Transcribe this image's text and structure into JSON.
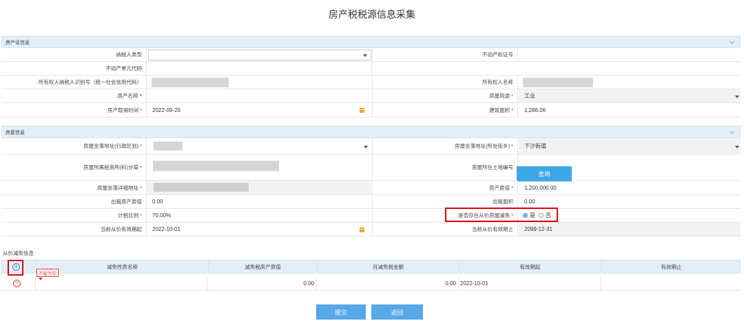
{
  "page_title": "房产税税源信息采集",
  "property_cert": {
    "section_title": "房产证信息",
    "taxpayer_type_label": "纳税人类型",
    "taxpayer_type_value": "",
    "real_estate_cert_label": "不动产权证号",
    "real_estate_cert_value": "",
    "unit_code_label": "不动产单元代码",
    "unit_code_value": "",
    "owner_id_label": "所有权人纳税人识别号（统一社会信用代码）",
    "owner_name_label": "所有权人名称",
    "property_name_label": "房产名称",
    "property_name_value": "",
    "house_use_label": "房屋用途",
    "house_use_value": "工业",
    "acquire_date_label": "房产取得时间",
    "acquire_date_value": "2022-09-20",
    "building_area_label": "建筑面积",
    "building_area_value": "1,286.06",
    "required_mark": "*"
  },
  "house_info": {
    "section_title": "房屋信息",
    "district_label": "房屋坐落地址(行政区划)",
    "street_label": "房屋坐落地址(所处街乡)",
    "street_value": "下沙街道",
    "tax_office_label": "房屋所属税务所(科)分局",
    "land_no_label": "房屋所在土地编号",
    "query_button": "查询",
    "detail_address_label": "房屋坐落详细地址",
    "original_value_label": "房产原值",
    "original_value": "1,200,000.00",
    "rent_original_label": "出租房产原值",
    "rent_original_value": "0.00",
    "rent_area_label": "出租面积",
    "rent_area_value": "0.00",
    "tax_ratio_label": "计税比例",
    "tax_ratio_value": "70.00%",
    "exempt_question_label": "是否存在从价房屋减免",
    "yes_label": "是",
    "no_label": "否",
    "selected_option": "是",
    "valid_start_label": "当前从价有效期起",
    "valid_start_value": "2022-10-01",
    "valid_end_label": "当前从价有效期止",
    "valid_end_value": "2099-12-31"
  },
  "exemption": {
    "section_title": "从价减免信息",
    "columns": [
      "减免性质名称",
      "减免税房产原值",
      "月减免税金额",
      "有效期起",
      "有效期止"
    ],
    "error_tag": "不能为空",
    "rows": [
      {
        "name": "",
        "original_value": "0.00",
        "monthly_amount": "0.00",
        "start": "2022-10-01",
        "end": ""
      }
    ]
  },
  "buttons": {
    "submit": "提交",
    "back": "返回"
  },
  "colors": {
    "section_header_bg": "#e3eef8",
    "primary_button": "#57a8e6",
    "highlight_red": "#e00000",
    "required_red": "#e02020",
    "calendar_icon": "#e8a72a"
  }
}
